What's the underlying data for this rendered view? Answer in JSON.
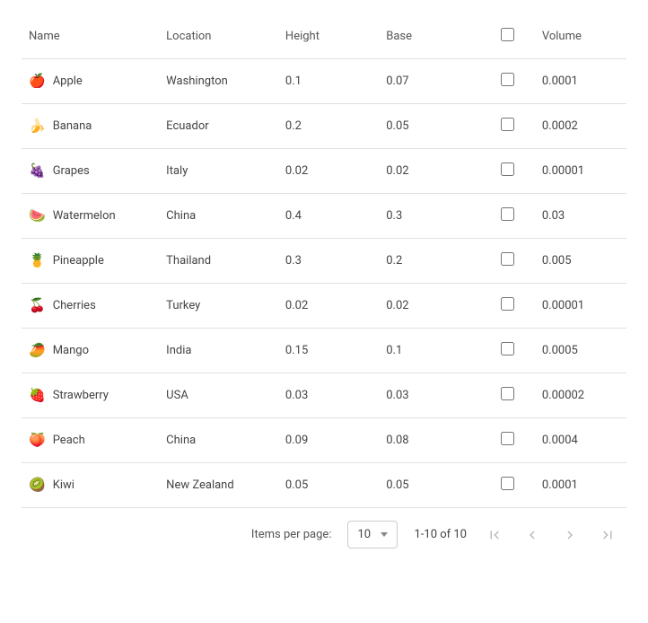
{
  "table": {
    "headers": {
      "name": "Name",
      "location": "Location",
      "height": "Height",
      "base": "Base",
      "volume": "Volume"
    },
    "rows": [
      {
        "icon": "🍎",
        "name": "Apple",
        "location": "Washington",
        "height": "0.1",
        "base": "0.07",
        "volume": "0.0001"
      },
      {
        "icon": "🍌",
        "name": "Banana",
        "location": "Ecuador",
        "height": "0.2",
        "base": "0.05",
        "volume": "0.0002"
      },
      {
        "icon": "🍇",
        "name": "Grapes",
        "location": "Italy",
        "height": "0.02",
        "base": "0.02",
        "volume": "0.00001"
      },
      {
        "icon": "🍉",
        "name": "Watermelon",
        "location": "China",
        "height": "0.4",
        "base": "0.3",
        "volume": "0.03"
      },
      {
        "icon": "🍍",
        "name": "Pineapple",
        "location": "Thailand",
        "height": "0.3",
        "base": "0.2",
        "volume": "0.005"
      },
      {
        "icon": "🍒",
        "name": "Cherries",
        "location": "Turkey",
        "height": "0.02",
        "base": "0.02",
        "volume": "0.00001"
      },
      {
        "icon": "🥭",
        "name": "Mango",
        "location": "India",
        "height": "0.15",
        "base": "0.1",
        "volume": "0.0005"
      },
      {
        "icon": "🍓",
        "name": "Strawberry",
        "location": "USA",
        "height": "0.03",
        "base": "0.03",
        "volume": "0.00002"
      },
      {
        "icon": "🍑",
        "name": "Peach",
        "location": "China",
        "height": "0.09",
        "base": "0.08",
        "volume": "0.0004"
      },
      {
        "icon": "🥝",
        "name": "Kiwi",
        "location": "New Zealand",
        "height": "0.05",
        "base": "0.05",
        "volume": "0.0001"
      }
    ]
  },
  "paginator": {
    "items_per_page_label": "Items per page:",
    "page_size": "10",
    "range_label": "1-10 of 10"
  }
}
